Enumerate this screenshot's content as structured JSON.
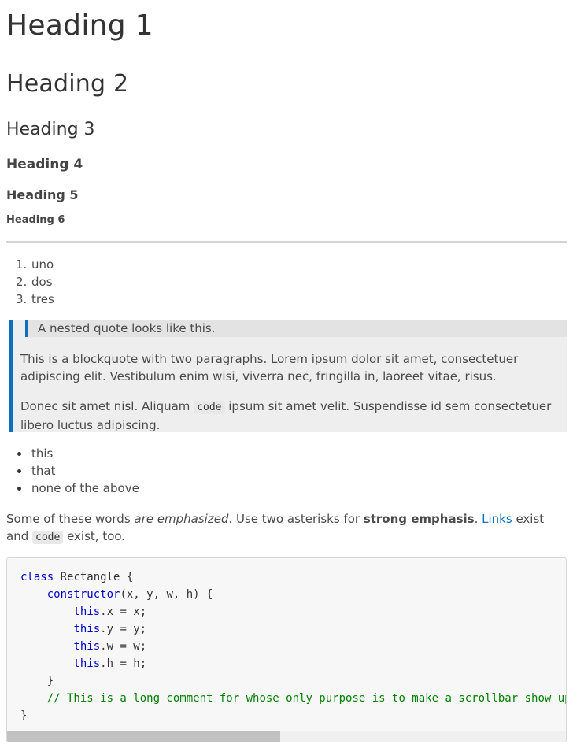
{
  "headings": {
    "h1": "Heading 1",
    "h2": "Heading 2",
    "h3": "Heading 3",
    "h4": "Heading 4",
    "h5": "Heading 5",
    "h6": "Heading 6"
  },
  "ordered_list": [
    {
      "num": "1.",
      "text": "uno"
    },
    {
      "num": "2.",
      "text": "dos"
    },
    {
      "num": "3.",
      "text": "tres"
    }
  ],
  "blockquote": {
    "nested": "A nested quote looks like this.",
    "paragraph1": "This is a blockquote with two paragraphs. Lorem ipsum dolor sit amet, consectetuer adipiscing elit. Vestibulum enim wisi, viverra nec, fringilla in, laoreet vitae, risus.",
    "paragraph2_before": "Donec sit amet nisl. Aliquam ",
    "paragraph2_code": "code",
    "paragraph2_after": " ipsum sit amet velit. Suspendisse id sem consectetuer libero luctus adipiscing."
  },
  "unordered_list": [
    "this",
    "that",
    "none of the above"
  ],
  "paragraph": {
    "t1": "Some of these words ",
    "em": "are emphasized",
    "t2": ". Use two asterisks for ",
    "strong": "strong emphasis",
    "t3": ". ",
    "link": "Links",
    "t4": " exist and ",
    "code": "code",
    "t5": " exist, too."
  },
  "code_block": {
    "l1_kw": "class",
    "l1_rest": " Rectangle {",
    "l2_indent": "    ",
    "l2_kw": "constructor",
    "l2_rest": "(x, y, w, h) {",
    "l3_indent": "        ",
    "l3_kw": "this",
    "l3_rest": ".x = x;",
    "l4_indent": "        ",
    "l4_kw": "this",
    "l4_rest": ".y = y;",
    "l5_indent": "        ",
    "l5_kw": "this",
    "l5_rest": ".w = w;",
    "l6_indent": "        ",
    "l6_kw": "this",
    "l6_rest": ".h = h;",
    "l7": "    }",
    "l8_indent": "    ",
    "l8_comment": "// This is a long comment for whose only purpose is to make a scrollbar show up.",
    "l9": "}"
  },
  "colors": {
    "accent": "#0e70c0",
    "keyword": "#0000c8",
    "comment": "#008000"
  }
}
